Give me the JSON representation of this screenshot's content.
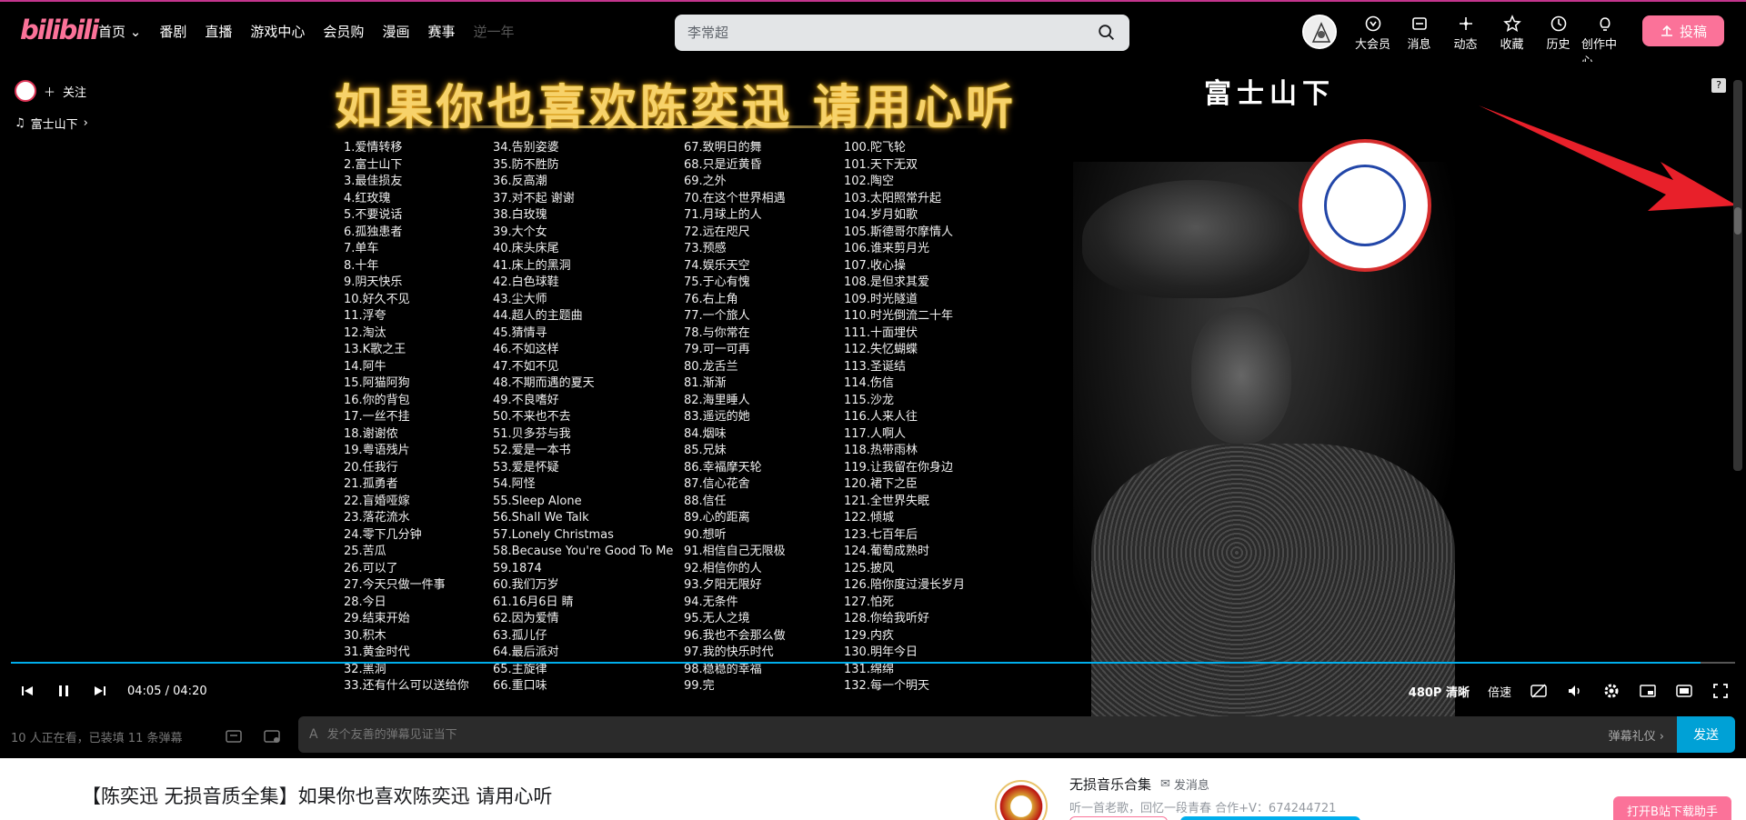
{
  "brand": {
    "logo": "bilibili",
    "accent": "#fb7299",
    "blue": "#00aeec"
  },
  "nav": {
    "items": [
      "首页",
      "番剧",
      "直播",
      "游戏中心",
      "会员购",
      "漫画",
      "赛事",
      "逆一年"
    ]
  },
  "search": {
    "placeholder": "李常超"
  },
  "right_nav": {
    "items": [
      "大会员",
      "消息",
      "动态",
      "收藏",
      "历史",
      "创作中心"
    ],
    "upload": "投稿"
  },
  "player": {
    "follow_label": "关注",
    "song_chip": "富士山下",
    "video_title_text": "如果你也喜欢陈奕迅 请用心听",
    "current_song": "富士山下",
    "seal_text": "无损音乐合集",
    "help": "?",
    "time_current": "04:05",
    "time_total": "04:20",
    "time_sep": "/",
    "progress": 0.98,
    "quality": "480P 清晰",
    "speed": "倍速"
  },
  "songs": {
    "col1": [
      "1.爱情转移",
      "2.富士山下",
      "3.最佳损友",
      "4.红玫瑰",
      "5.不要说话",
      "6.孤独患者",
      "7.单车",
      "8.十年",
      "9.阴天快乐",
      "10.好久不见",
      "11.浮夸",
      "12.淘汰",
      "13.K歌之王",
      "14.阿牛",
      "15.阿猫阿狗",
      "16.你的背包",
      "17.一丝不挂",
      "18.谢谢侬",
      "19.粤语残片",
      "20.任我行",
      "21.孤勇者",
      "22.盲婚哑嫁",
      "23.落花流水",
      "24.零下几分钟",
      "25.苦瓜",
      "26.可以了",
      "27.今天只做一件事",
      "28.今日",
      "29.结束开始",
      "30.积木",
      "31.黄金时代",
      "32.黑洞",
      "33.还有什么可以送给你"
    ],
    "col2": [
      "34.告别姿婆",
      "35.防不胜防",
      "36.反高潮",
      "37.对不起 谢谢",
      "38.白玫瑰",
      "39.大个女",
      "40.床头床尾",
      "41.床上的黑洞",
      "42.白色球鞋",
      "43.尘大师",
      "44.超人的主题曲",
      "45.猜情寻",
      "46.不如这样",
      "47.不如不见",
      "48.不期而遇的夏天",
      "49.不良嗜好",
      "50.不来也不去",
      "51.贝多芬与我",
      "52.爱是一本书",
      "53.爱是怀疑",
      "54.阿怪",
      "55.Sleep Alone",
      "56.Shall We Talk",
      "57.Lonely Christmas",
      "58.Because You're Good To Me",
      "59.1874",
      "60.我们万岁",
      "61.16月6日 睛",
      "62.因为爱情",
      "63.孤儿仔",
      "64.最后派对",
      "65.主旋律",
      "66.重口味"
    ],
    "col3": [
      "67.致明日的舞",
      "68.只是近黄昏",
      "69.之外",
      "70.在这个世界相遇",
      "71.月球上的人",
      "72.远在咫尺",
      "73.预感",
      "74.娱乐天空",
      "75.于心有愧",
      "76.右上角",
      "77.一个旅人",
      "78.与你常在",
      "79.可一可再",
      "80.龙舌兰",
      "81.渐渐",
      "82.海里睡人",
      "83.遥远的她",
      "84.烟味",
      "85.兄妹",
      "86.幸福摩天轮",
      "87.信心花舍",
      "88.信任",
      "89.心的距离",
      "90.想听",
      "91.相信自己无限极",
      "92.相信你的人",
      "93.夕阳无限好",
      "94.无条件",
      "95.无人之境",
      "96.我也不会那么做",
      "97.我的快乐时代",
      "98.稳稳的幸福",
      "99.完"
    ],
    "col4": [
      "100.陀飞轮",
      "101.天下无双",
      "102.陶空",
      "103.太阳照常升起",
      "104.岁月如歌",
      "105.斯德哥尔摩情人",
      "106.谁来剪月光",
      "107.收心操",
      "108.是但求其爱",
      "109.时光隧道",
      "110.时光倒流二十年",
      "111.十面埋伏",
      "112.失忆蝴蝶",
      "113.圣诞结",
      "114.伤信",
      "115.沙龙",
      "116.人来人往",
      "117.人啊人",
      "118.热带雨林",
      "119.让我留在你身边",
      "120.裙下之臣",
      "121.全世界失眠",
      "122.倾城",
      "123.七百年后",
      "124.葡萄成熟时",
      "125.披风",
      "126.陪你度过漫长岁月",
      "127.怕死",
      "128.你给我听好",
      "129.内疚",
      "130.明年今日",
      "131.绵绵",
      "132.每一个明天"
    ]
  },
  "danmaku": {
    "viewers": "10 人正在看，已装填 11 条弹幕",
    "placeholder": "发个友善的弹幕见证当下",
    "etiquette": "弹幕礼仪 ›",
    "send": "发送",
    "aa": "A"
  },
  "below": {
    "video_title": "【陈奕迅 无损音质全集】如果你也喜欢陈奕迅 请用心听",
    "uploader_name": "无损音乐合集",
    "send_message": "发消息",
    "uploader_desc": "听一首老歌，回忆一段青春 合作+V：674244721",
    "download_app": "打开B站下载助手"
  }
}
